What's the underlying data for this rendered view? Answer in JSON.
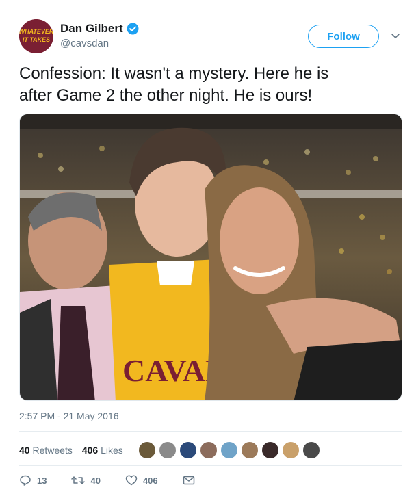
{
  "user": {
    "display_name": "Dan Gilbert",
    "handle": "@cavsdan",
    "avatar_text_1": "WHATEVER",
    "avatar_text_2": "IT TAKES",
    "verified": true
  },
  "follow_label": "Follow",
  "tweet": {
    "text_line1": "Confession: It wasn't a mystery. Here he is",
    "text_line2": "after Game 2 the other night. He is ours!",
    "timestamp": "2:57 PM - 21 May 2016"
  },
  "photo": {
    "jersey_text": "CAVALIE"
  },
  "stats": {
    "retweets_count": "40",
    "retweets_label": "Retweets",
    "likes_count": "406",
    "likes_label": "Likes"
  },
  "actions": {
    "reply_count": "13",
    "retweet_count": "40",
    "like_count": "406"
  },
  "colors": {
    "accent": "#1da1f2",
    "muted": "#657786",
    "text": "#14171a",
    "avatar_bg": "#7a1f33"
  },
  "likers": [
    "#6b5a3a",
    "#8a8a8a",
    "#2b4a7a",
    "#8c6c5c",
    "#6fa3c8",
    "#9c7a5a",
    "#3a2a2a",
    "#c9a06a",
    "#4a4a4a"
  ]
}
